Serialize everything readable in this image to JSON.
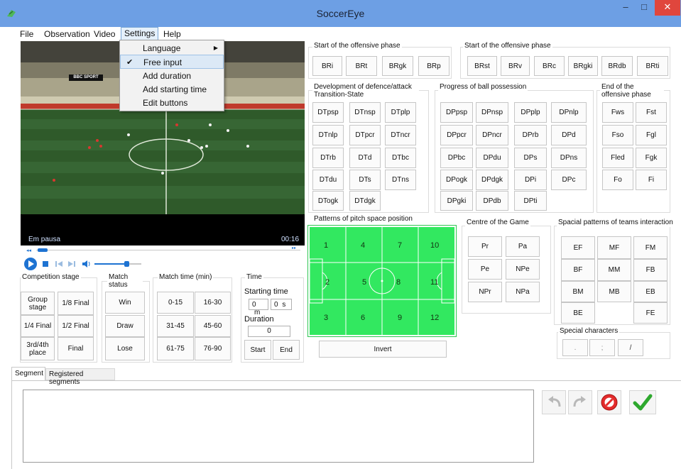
{
  "window": {
    "title": "SoccerEye",
    "minimize": "–",
    "maximize": "□",
    "close": "✕"
  },
  "menubar": {
    "file": "File",
    "observation": "Observation",
    "video": "Video",
    "settings": "Settings",
    "help": "Help"
  },
  "settings_menu": {
    "language": "Language",
    "free_input": "Free input",
    "add_duration": "Add duration",
    "add_starting_time": "Add starting time",
    "edit_buttons": "Edit buttons"
  },
  "video": {
    "overlay_brand": "BBC SPORT",
    "status": "Em pausa",
    "time": "00:16"
  },
  "competition_stage": {
    "label": "Competition stage",
    "buttons": [
      "Group stage",
      "1/8 Final",
      "1/4 Final",
      "1/2 Final",
      "3rd/4th place",
      "Final"
    ]
  },
  "match_status": {
    "label": "Match status",
    "buttons": [
      "Win",
      "Draw",
      "Lose"
    ]
  },
  "match_time": {
    "label": "Match time (min)",
    "buttons": [
      "0-15",
      "16-30",
      "31-45",
      "45-60",
      "61-75",
      "76-90"
    ]
  },
  "time_panel": {
    "label": "Time",
    "starting_time": "Starting time",
    "minutes": "0",
    "m": "m",
    "seconds": "0",
    "s": "s",
    "duration_label": "Duration",
    "duration_value": "0",
    "start": "Start",
    "end": "End"
  },
  "offensive_start_1": {
    "label": "Start of the offensive phase",
    "buttons": [
      "BRi",
      "BRt",
      "BRgk",
      "BRp"
    ]
  },
  "offensive_start_2": {
    "label": "Start of the offensive phase",
    "buttons": [
      "BRst",
      "BRv",
      "BRc",
      "BRgki",
      "BRdb",
      "BRti"
    ]
  },
  "development": {
    "label": "Development of defence/attack Transition-State",
    "buttons": [
      "DTpsp",
      "DTnsp",
      "DTplp",
      "DTnlp",
      "DTpcr",
      "DTncr",
      "DTrb",
      "DTd",
      "DTbc",
      "DTdu",
      "DTs",
      "DTns",
      "DTogk",
      "DTdgk"
    ]
  },
  "progress": {
    "label": "Progress of ball possession",
    "buttons": [
      "DPpsp",
      "DPnsp",
      "DPplp",
      "DPnlp",
      "DPpcr",
      "DPncr",
      "DPrb",
      "DPd",
      "DPbc",
      "DPdu",
      "DPs",
      "DPns",
      "DPogk",
      "DPdgk",
      "DPi",
      "DPc",
      "DPgki",
      "DPdb",
      "DPti"
    ]
  },
  "offensive_end": {
    "label": "End of the offensive phase",
    "buttons": [
      "Fws",
      "Fst",
      "Fso",
      "Fgl",
      "Fled",
      "Fgk",
      "Fo",
      "Fi"
    ]
  },
  "pitch": {
    "label": "Patterns of pitch space position",
    "zones": [
      "1",
      "4",
      "7",
      "10",
      "2",
      "5",
      "8",
      "11",
      "3",
      "6",
      "9",
      "12"
    ]
  },
  "invert": "Invert",
  "centre": {
    "label": "Centre of the Game",
    "buttons": [
      "Pr",
      "Pa",
      "Pe",
      "NPe",
      "NPr",
      "NPa"
    ]
  },
  "spatial": {
    "label": "Spacial patterns of teams interaction",
    "buttons": [
      "EF",
      "MF",
      "FM",
      "BF",
      "MM",
      "FB",
      "BM",
      "MB",
      "EB",
      "BE",
      "FE"
    ]
  },
  "special_chars": {
    "label": "Special characters",
    "buttons": [
      ".",
      ";",
      "/"
    ]
  },
  "tabs": {
    "segment": "Segment",
    "registered": "Registered segments"
  },
  "colors": {
    "titlebar": "#6d9fe4",
    "close": "#e0463d",
    "pitch": "#32e860",
    "accent": "#1e73d2"
  }
}
